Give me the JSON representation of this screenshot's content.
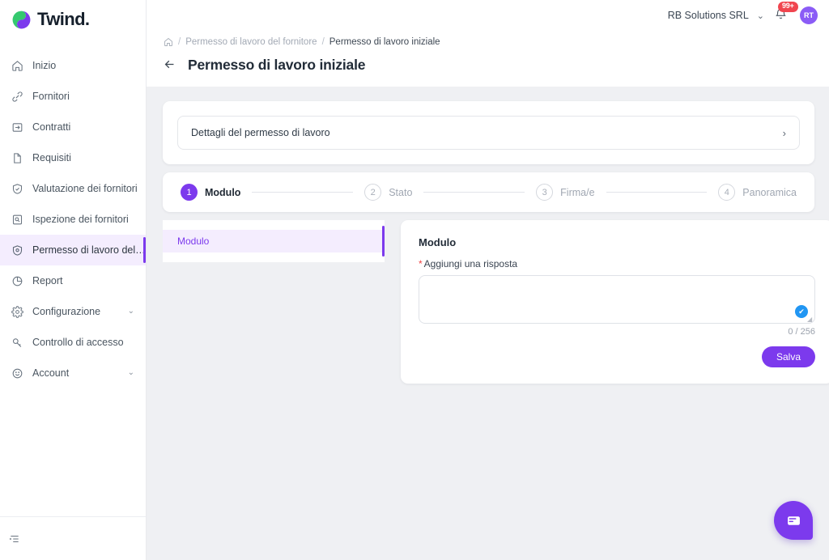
{
  "brand": {
    "name": "Twind.",
    "logo_icon": "twind-swirl-logo",
    "green": "#35c96f",
    "purple": "#7c3aed"
  },
  "sidebar": {
    "items": [
      {
        "label": "Inizio",
        "icon": "home-icon",
        "active": false,
        "chevron": false
      },
      {
        "label": "Fornitori",
        "icon": "link-icon",
        "active": false,
        "chevron": false
      },
      {
        "label": "Contratti",
        "icon": "contract-icon",
        "active": false,
        "chevron": false
      },
      {
        "label": "Requisiti",
        "icon": "document-icon",
        "active": false,
        "chevron": false
      },
      {
        "label": "Valutazione dei fornitori",
        "icon": "shield-check-icon",
        "active": false,
        "chevron": false
      },
      {
        "label": "Ispezione dei fornitori",
        "icon": "inspection-icon",
        "active": false,
        "chevron": false
      },
      {
        "label": "Permesso di lavoro del f...",
        "icon": "shield-permit-icon",
        "active": true,
        "chevron": false
      },
      {
        "label": "Report",
        "icon": "pie-chart-icon",
        "active": false,
        "chevron": false
      },
      {
        "label": "Configurazione",
        "icon": "gear-icon",
        "active": false,
        "chevron": true
      },
      {
        "label": "Controllo di accesso",
        "icon": "key-icon",
        "active": false,
        "chevron": false
      },
      {
        "label": "Account",
        "icon": "smiley-icon",
        "active": false,
        "chevron": true
      }
    ],
    "footer_icon": "collapse-sidebar-icon",
    "chevron_glyph": "⌄"
  },
  "topbar": {
    "org_name": "RB Solutions SRL",
    "org_chevron": "⌄",
    "bell_icon": "bell-icon",
    "notification_count": "99+",
    "avatar_initials": "RT"
  },
  "breadcrumb": {
    "home_icon": "home-icon",
    "sep": "/",
    "parent": "Permesso di lavoro del fornitore",
    "current": "Permesso di lavoro iniziale"
  },
  "page": {
    "back_icon": "arrow-left-icon",
    "title": "Permesso di lavoro iniziale"
  },
  "accordion": {
    "label": "Dettagli del permesso di lavoro",
    "arrow_icon": "chevron-right-icon",
    "arrow_glyph": "›"
  },
  "stepper": {
    "steps": [
      {
        "num": "1",
        "label": "Modulo",
        "state": "done"
      },
      {
        "num": "2",
        "label": "Stato",
        "state": "todo"
      },
      {
        "num": "3",
        "label": "Firma/e",
        "state": "todo"
      },
      {
        "num": "4",
        "label": "Panoramica",
        "state": "todo"
      }
    ]
  },
  "subnav": {
    "items": [
      {
        "label": "Modulo",
        "active": true
      }
    ]
  },
  "form": {
    "title": "Modulo",
    "required_mark": "*",
    "answer_label": "Aggiungi una risposta",
    "answer_value": "",
    "answer_placeholder": "",
    "valid_icon": "check-circle-icon",
    "valid_glyph": "✔",
    "counter": "0 / 256",
    "save_label": "Salva"
  },
  "chat": {
    "icon": "chat-message-icon",
    "label": "Chat"
  }
}
